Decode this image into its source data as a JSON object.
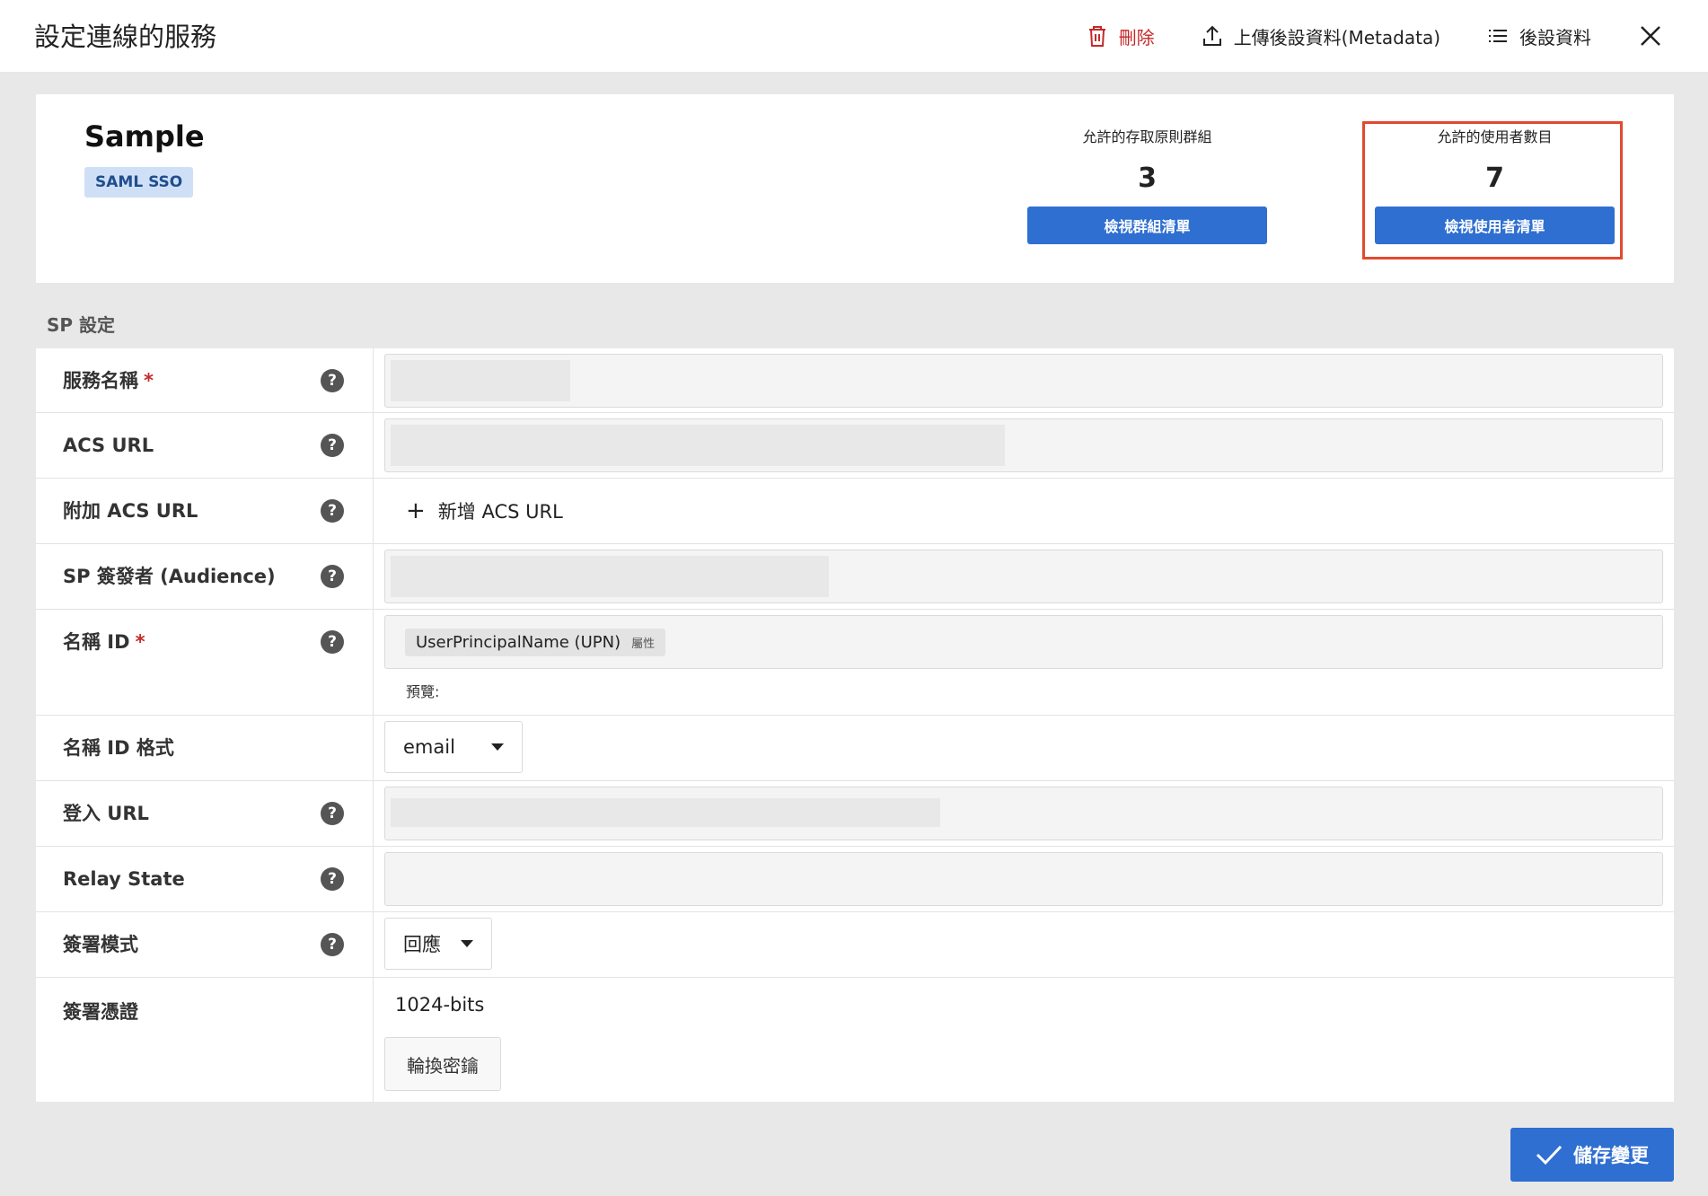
{
  "header": {
    "title": "設定連線的服務",
    "delete_label": "刪除",
    "upload_label": "上傳後設資料(Metadata)",
    "metadata_label": "後設資料"
  },
  "summary": {
    "app_name": "Sample",
    "badge": "SAML SSO",
    "groups_label": "允許的存取原則群組",
    "groups_count": "3",
    "groups_button": "檢視群組清單",
    "users_label": "允許的使用者數目",
    "users_count": "7",
    "users_button": "檢視使用者清單"
  },
  "section": {
    "label": "SP 設定"
  },
  "form": {
    "service_name_label": "服務名稱",
    "acs_url_label": "ACS URL",
    "extra_acs_label": "附加 ACS URL",
    "add_acs_label": "新增 ACS URL",
    "sp_issuer_label": "SP 簽發者 (Audience)",
    "name_id_label": "名稱 ID",
    "name_id_chip": "UserPrincipalName (UPN)",
    "name_id_chip_tag": "屬性",
    "preview_label": "預覽:",
    "name_id_format_label": "名稱 ID 格式",
    "name_id_format_value": "email",
    "login_url_label": "登入 URL",
    "relay_state_label": "Relay State",
    "sign_mode_label": "簽署模式",
    "sign_mode_value": "回應",
    "sign_cert_label": "簽署憑證",
    "sign_cert_value": "1024-bits",
    "rotate_key_button": "輪換密鑰",
    "required_mark": "*",
    "help_glyph": "?"
  },
  "footer": {
    "save_label": "儲存變更"
  },
  "colors": {
    "primary": "#2f6fd1",
    "danger": "#c62828",
    "highlight": "#e24a2e"
  }
}
